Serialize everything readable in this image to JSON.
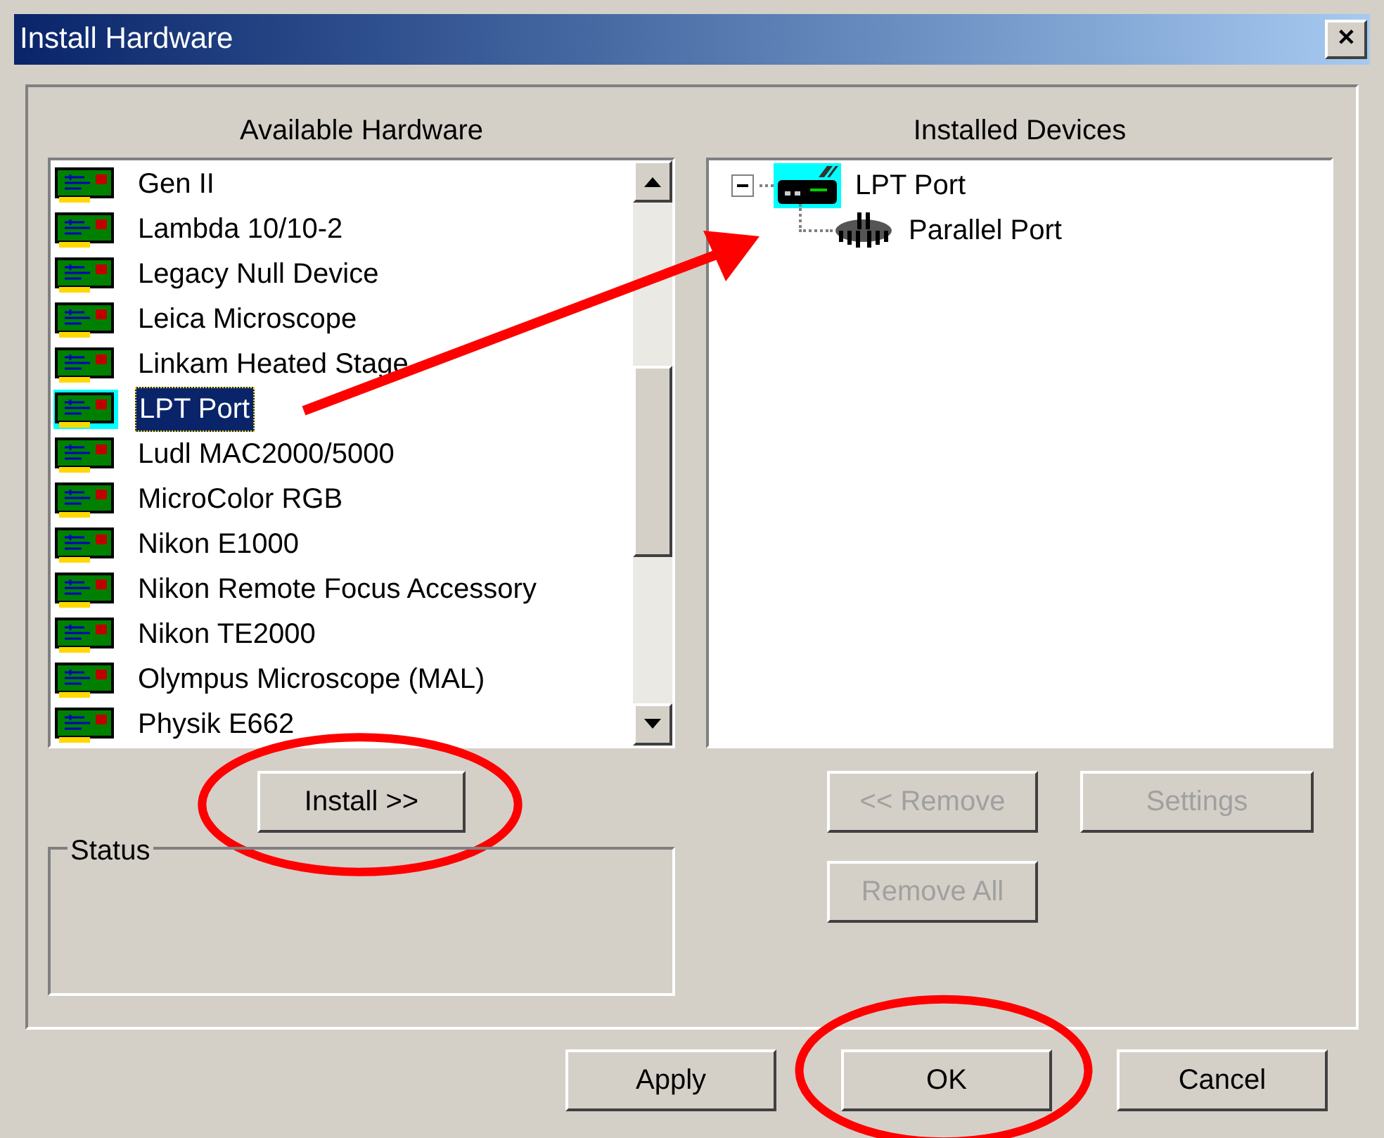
{
  "window": {
    "title": "Install Hardware",
    "close": "✕"
  },
  "available": {
    "heading": "Available Hardware",
    "items": [
      {
        "label": "Gen II",
        "selected": false
      },
      {
        "label": "Lambda 10/10-2",
        "selected": false
      },
      {
        "label": "Legacy Null Device",
        "selected": false
      },
      {
        "label": "Leica Microscope",
        "selected": false
      },
      {
        "label": "Linkam Heated Stage",
        "selected": false
      },
      {
        "label": "LPT Port",
        "selected": true
      },
      {
        "label": "Ludl MAC2000/5000",
        "selected": false
      },
      {
        "label": "MicroColor RGB",
        "selected": false
      },
      {
        "label": "Nikon E1000",
        "selected": false
      },
      {
        "label": "Nikon Remote Focus Accessory",
        "selected": false
      },
      {
        "label": "Nikon TE2000",
        "selected": false
      },
      {
        "label": "Olympus Microscope (MAL)",
        "selected": false
      },
      {
        "label": "Physik E662",
        "selected": false
      }
    ],
    "install_button": {
      "label": "Install >>",
      "disabled": false,
      "circled": true
    }
  },
  "installed": {
    "heading": "Installed Devices",
    "tree": [
      {
        "label": "LPT Port",
        "kind": "port",
        "selected": true,
        "expanded": true,
        "children": [
          {
            "label": "Parallel Port",
            "kind": "connector",
            "selected": false
          }
        ]
      }
    ],
    "buttons": [
      {
        "label": "<< Remove",
        "disabled": true
      },
      {
        "label": "Settings",
        "disabled": true
      },
      {
        "label": "Remove All",
        "disabled": true
      }
    ]
  },
  "status": {
    "label": "Status"
  },
  "annotation_arrow": true,
  "footer_buttons": [
    {
      "label": "Apply",
      "disabled": false,
      "circled": false
    },
    {
      "label": "OK",
      "disabled": false,
      "circled": true
    },
    {
      "label": "Cancel",
      "disabled": false,
      "circled": false
    }
  ]
}
